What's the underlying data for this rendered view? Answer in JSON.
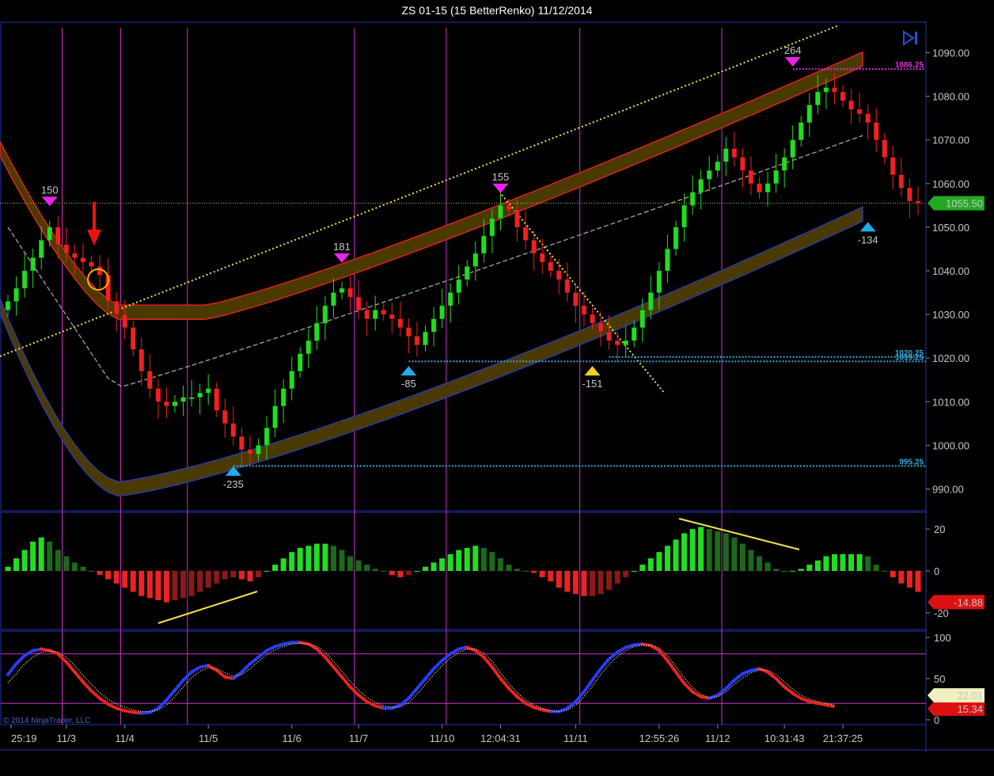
{
  "window": {
    "title": "ZS 01-15 (15 BetterRenko)  11/12/2014"
  },
  "copyright": "© 2014 NinjaTrader, LLC",
  "colors": {
    "up": "#22dd22",
    "down": "#ee2222",
    "band": "#4a3a00",
    "grid": "#cc33cc",
    "axis": "#2233aa",
    "trend": "#f2e24a",
    "last_price": "#22aa22"
  },
  "icons": [
    "play-end-icon",
    "arrow-down-icon",
    "circle-marker-icon"
  ],
  "chart_data": [
    {
      "type": "candlestick",
      "panel": "price",
      "ylim": [
        985,
        1097
      ],
      "ytick_labels": [
        "990.00",
        "1000.00",
        "1010.00",
        "1020.00",
        "1030.00",
        "1040.00",
        "1050.00",
        "1060.00",
        "1070.00",
        "1080.00",
        "1090.00"
      ],
      "ytick_values": [
        990,
        1000,
        1010,
        1020,
        1030,
        1040,
        1050,
        1060,
        1070,
        1080,
        1090
      ],
      "xtick_labels": [
        "25:19",
        "11/3",
        "11/4",
        "11/5",
        "11/6",
        "11/7",
        "11/10",
        "12:04:31",
        "11/11",
        "12:55:26",
        "11/12",
        "10:31:43",
        "21:37:25"
      ],
      "xtick_bars": [
        0,
        7,
        14,
        24,
        34,
        42,
        52,
        59,
        68,
        78,
        85,
        93,
        100
      ],
      "session_breaks": [
        6,
        13,
        21,
        41,
        52,
        68,
        85
      ],
      "closes": [
        1033,
        1036,
        1040,
        1043,
        1047,
        1050,
        1046,
        1044,
        1043,
        1042,
        1041,
        1039,
        1033,
        1030,
        1027,
        1022,
        1017,
        1013,
        1010,
        1009,
        1010,
        1011,
        1011,
        1012,
        1013,
        1008,
        1005,
        1002,
        999,
        998,
        1000,
        1004,
        1009,
        1013,
        1017,
        1021,
        1024,
        1028,
        1032,
        1035,
        1036,
        1034,
        1031,
        1029,
        1031,
        1030,
        1029,
        1027,
        1025,
        1023,
        1026,
        1029,
        1032,
        1035,
        1038,
        1041,
        1044,
        1048,
        1052,
        1055,
        1054,
        1050,
        1047,
        1044,
        1042,
        1040,
        1038,
        1035,
        1032,
        1030,
        1028,
        1026,
        1024,
        1023,
        1024,
        1027,
        1031,
        1035,
        1040,
        1045,
        1050,
        1055,
        1058,
        1061,
        1063,
        1065,
        1068,
        1066,
        1063,
        1060,
        1058,
        1060,
        1063,
        1066,
        1070,
        1074,
        1078,
        1081,
        1082,
        1081,
        1079,
        1077,
        1076,
        1074,
        1070,
        1066,
        1062,
        1059,
        1056,
        1055.5
      ],
      "swing_labels": [
        {
          "bar": 5,
          "price": 1055,
          "text": "150",
          "dir": "high"
        },
        {
          "bar": 40,
          "price": 1042,
          "text": "181",
          "dir": "high"
        },
        {
          "bar": 59,
          "price": 1058,
          "text": "155",
          "dir": "high"
        },
        {
          "bar": 94,
          "price": 1087,
          "text": "264",
          "dir": "high"
        },
        {
          "bar": 27,
          "price": 995,
          "text": "-235",
          "dir": "low"
        },
        {
          "bar": 48,
          "price": 1018,
          "text": "-85",
          "dir": "low"
        },
        {
          "bar": 70,
          "price": 1018,
          "text": "-151",
          "dir": "low"
        },
        {
          "bar": 103,
          "price": 1051,
          "text": "-134",
          "dir": "low"
        }
      ],
      "levels": [
        {
          "price": 1086.25,
          "label": "1086.25",
          "color": "#dd33dd",
          "from_bar": 94
        },
        {
          "price": 1020.25,
          "label": "1020.25",
          "color": "#33aadd",
          "from_bar": 72
        },
        {
          "price": 1019.25,
          "label": "1019.25",
          "color": "#33aadd",
          "from_bar": 48
        },
        {
          "price": 995.25,
          "label": "995.25",
          "color": "#33aadd",
          "from_bar": 27
        }
      ],
      "last_price": {
        "value": 1055.5,
        "label": "1055.50"
      }
    },
    {
      "type": "bar",
      "panel": "histogram",
      "ylim": [
        -28,
        28
      ],
      "ytick_labels": [
        "20",
        "0",
        "-20"
      ],
      "ytick_values": [
        20,
        0,
        -20
      ],
      "values": [
        2,
        6,
        10,
        14,
        16,
        14,
        10,
        7,
        4,
        2,
        0,
        -2,
        -4,
        -6,
        -8,
        -10,
        -12,
        -13,
        -14,
        -15,
        -14,
        -13,
        -12,
        -10,
        -8,
        -6,
        -4,
        -3,
        -4,
        -5,
        -3,
        0,
        3,
        6,
        9,
        11,
        12,
        13,
        13,
        12,
        10,
        7,
        5,
        3,
        1,
        0,
        -2,
        -3,
        -2,
        0,
        2,
        4,
        6,
        8,
        10,
        11,
        12,
        11,
        9,
        6,
        3,
        1,
        0,
        -1,
        -3,
        -5,
        -8,
        -10,
        -11,
        -12,
        -12,
        -11,
        -9,
        -6,
        -3,
        0,
        3,
        6,
        9,
        12,
        15,
        18,
        20,
        21,
        20,
        19,
        18,
        16,
        13,
        10,
        7,
        4,
        1,
        0,
        0,
        1,
        3,
        5,
        7,
        8,
        8,
        8,
        8,
        7,
        3,
        0,
        -3,
        -6,
        -8,
        -10
      ],
      "last_value": {
        "value": -14.88,
        "label": "-14.88"
      }
    },
    {
      "type": "line",
      "panel": "stochastic",
      "ylim": [
        0,
        100
      ],
      "ytick_labels": [
        "100",
        "50",
        "0"
      ],
      "ytick_values": [
        100,
        50,
        0
      ],
      "reference_lines": [
        80,
        20
      ],
      "series": [
        {
          "values": [
            55,
            68,
            78,
            84,
            86,
            84,
            80,
            70,
            58,
            46,
            35,
            26,
            19,
            14,
            11,
            9,
            8,
            9,
            14,
            24,
            36,
            48,
            58,
            64,
            66,
            60,
            52,
            50,
            58,
            68,
            76,
            84,
            89,
            92,
            94,
            94,
            92,
            86,
            76,
            64,
            52,
            40,
            30,
            22,
            17,
            14,
            14,
            18,
            26,
            38,
            50,
            62,
            72,
            80,
            86,
            88,
            84,
            76,
            64,
            50,
            38,
            28,
            20,
            15,
            12,
            10,
            10,
            14,
            22,
            34,
            48,
            62,
            74,
            82,
            88,
            91,
            92,
            90,
            84,
            72,
            58,
            44,
            34,
            28,
            26,
            30,
            38,
            48,
            56,
            60,
            62,
            58,
            50,
            40,
            32,
            26,
            22,
            20,
            18,
            16
          ]
        },
        {
          "values": [
            45,
            56,
            68,
            76,
            82,
            84,
            82,
            76,
            66,
            54,
            43,
            33,
            25,
            19,
            15,
            12,
            10,
            10,
            12,
            18,
            28,
            40,
            51,
            59,
            63,
            62,
            57,
            53,
            55,
            62,
            71,
            79,
            85,
            89,
            92,
            93,
            92,
            89,
            82,
            71,
            59,
            47,
            36,
            27,
            21,
            17,
            15,
            16,
            21,
            31,
            43,
            55,
            66,
            75,
            82,
            86,
            86,
            81,
            71,
            57,
            44,
            33,
            24,
            18,
            14,
            11,
            10,
            12,
            18,
            28,
            41,
            55,
            67,
            77,
            84,
            89,
            91,
            91,
            87,
            78,
            65,
            51,
            39,
            31,
            27,
            28,
            34,
            43,
            51,
            57,
            61,
            60,
            55,
            46,
            37,
            30,
            25,
            22,
            20,
            18
          ]
        }
      ],
      "last_values": [
        {
          "value": 22.01,
          "label": "22.01"
        },
        {
          "value": 15.34,
          "label": "15.34"
        }
      ]
    }
  ]
}
